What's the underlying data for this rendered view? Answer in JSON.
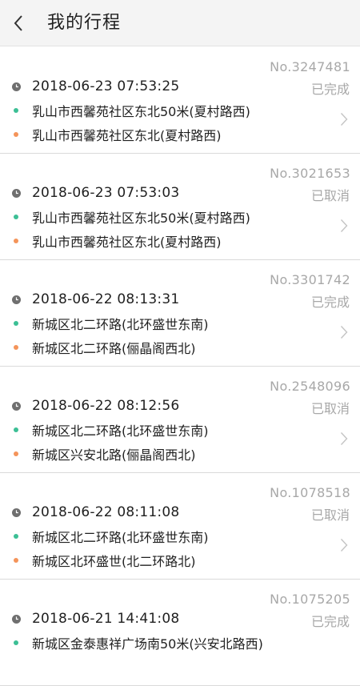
{
  "header": {
    "title": "我的行程"
  },
  "colors": {
    "start_dot": "#3cbf95",
    "end_dot": "#f4945a",
    "muted_text": "#a8a8a8"
  },
  "trips": [
    {
      "no": "No.3247481",
      "status": "已完成",
      "time": "2018-06-23 07:53:25",
      "from": "乳山市西馨苑社区东北50米(夏村路西)",
      "to": "乳山市西馨苑社区东北(夏村路西)"
    },
    {
      "no": "No.3021653",
      "status": "已取消",
      "time": "2018-06-23 07:53:03",
      "from": "乳山市西馨苑社区东北50米(夏村路西)",
      "to": "乳山市西馨苑社区东北(夏村路西)"
    },
    {
      "no": "No.3301742",
      "status": "已完成",
      "time": "2018-06-22 08:13:31",
      "from": "新城区北二环路(北环盛世东南)",
      "to": "新城区北二环路(俪晶阁西北)"
    },
    {
      "no": "No.2548096",
      "status": "已取消",
      "time": "2018-06-22 08:12:56",
      "from": "新城区北二环路(北环盛世东南)",
      "to": "新城区兴安北路(俪晶阁西北)"
    },
    {
      "no": "No.1078518",
      "status": "已取消",
      "time": "2018-06-22 08:11:08",
      "from": "新城区北二环路(北环盛世东南)",
      "to": "新城区北环盛世(北二环路北)"
    },
    {
      "no": "No.1075205",
      "status": "已完成",
      "time": "2018-06-21 14:41:08",
      "from": "新城区金泰惠祥广场南50米(兴安北路西)",
      "to": ""
    }
  ]
}
